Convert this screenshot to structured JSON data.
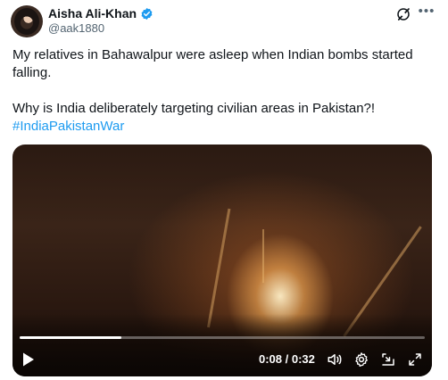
{
  "author": {
    "display_name": "Aisha Ali-Khan",
    "handle": "@aak1880",
    "verified_icon": "verified-badge-icon"
  },
  "header_icons": [
    "grok-icon",
    "more-options-icon"
  ],
  "tweet": {
    "line1": "My relatives in Bahawalpur were asleep when Indian bombs started falling.",
    "line2": "Why is India deliberately targeting civilian areas in Pakistan?!",
    "hashtag": "#IndiaPakistanWar"
  },
  "video": {
    "time_label": "0:08 / 0:32",
    "progress": 0.25,
    "controls": [
      "play-icon",
      "volume-icon",
      "settings-icon",
      "minimize-icon",
      "fullscreen-icon"
    ]
  },
  "colors": {
    "accent": "#1d9bf0",
    "text": "#0f1419",
    "muted": "#536471"
  }
}
